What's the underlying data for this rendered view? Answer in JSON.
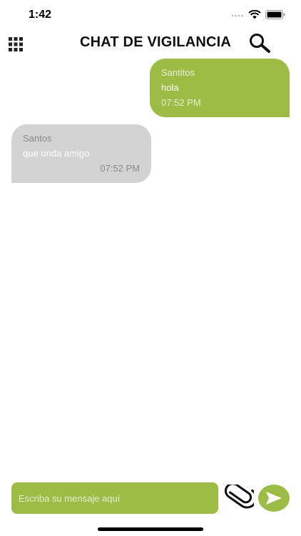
{
  "status_bar": {
    "time": "1:42"
  },
  "header": {
    "title": "CHAT DE VIGILANCIA",
    "menu_icon": "grid-icon",
    "search_icon": "search-icon"
  },
  "messages": [
    {
      "sender": "Santitos",
      "text": "hola",
      "time": "07:52 PM",
      "direction": "outgoing"
    },
    {
      "sender": "Santos",
      "text": "que onda amigo",
      "time": "07:52 PM",
      "direction": "incoming"
    }
  ],
  "composer": {
    "placeholder": "Escriba su mensaje aquí",
    "value": "",
    "attach_icon": "paperclip-icon",
    "send_icon": "send-arrow-icon"
  },
  "colors": {
    "accent": "#9cbc46",
    "incoming_bubble": "#d3d3d3",
    "background": "#ffffff"
  }
}
